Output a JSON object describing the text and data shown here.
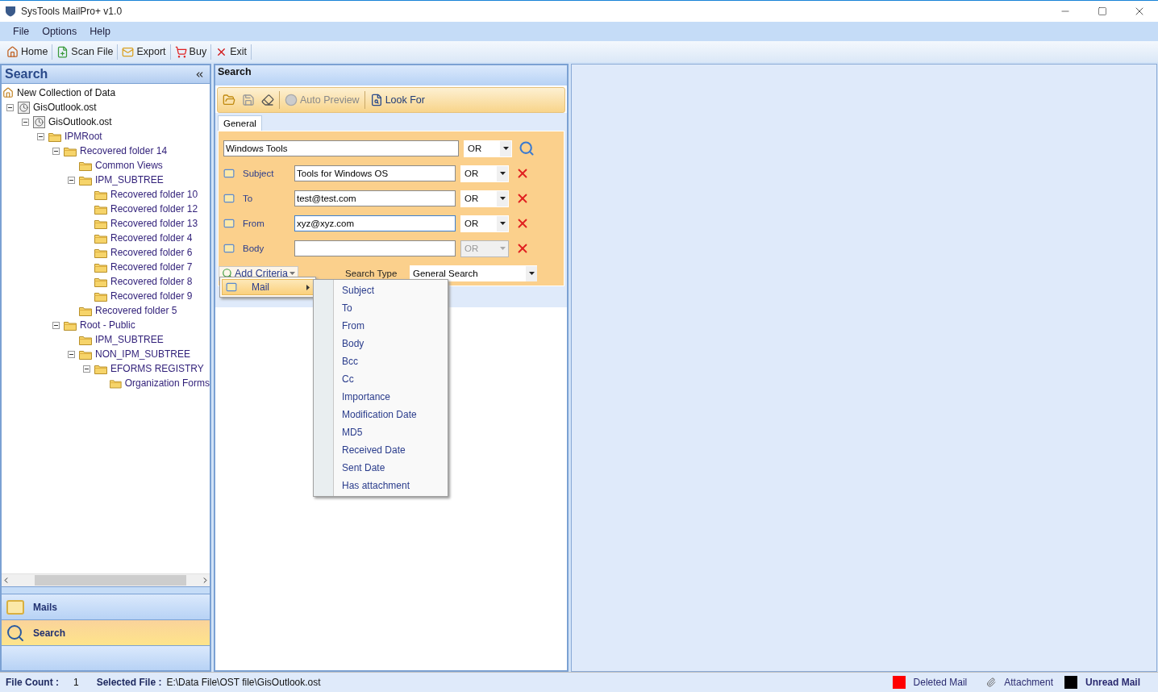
{
  "window": {
    "title": "SysTools MailPro+ v1.0"
  },
  "menu": [
    "File",
    "Options",
    "Help"
  ],
  "toolbar": [
    {
      "kind": "home",
      "label": "Home"
    },
    {
      "kind": "scan",
      "label": "Scan File"
    },
    {
      "kind": "export",
      "label": "Export"
    },
    {
      "kind": "buy",
      "label": "Buy"
    },
    {
      "kind": "exit",
      "label": "Exit"
    }
  ],
  "sidebar": {
    "title": "Search",
    "tree": [
      {
        "kind": "collection",
        "label": "New Collection of Data"
      },
      {
        "kind": "store",
        "label": "GisOutlook.ost",
        "expanded": true,
        "children": [
          {
            "kind": "store",
            "label": "GisOutlook.ost",
            "expanded": true,
            "children": [
              {
                "kind": "folder",
                "label": "IPMRoot",
                "expanded": true,
                "children": [
                  {
                    "kind": "folder",
                    "label": "Recovered folder 14",
                    "expanded": true,
                    "children": [
                      {
                        "kind": "folder",
                        "label": "Common Views"
                      },
                      {
                        "kind": "folder",
                        "label": "IPM_SUBTREE",
                        "expanded": true,
                        "children": [
                          {
                            "kind": "folder",
                            "label": "Recovered folder 10"
                          },
                          {
                            "kind": "folder",
                            "label": "Recovered folder 12"
                          },
                          {
                            "kind": "folder",
                            "label": "Recovered folder 13"
                          },
                          {
                            "kind": "folder",
                            "label": "Recovered folder 4"
                          },
                          {
                            "kind": "folder",
                            "label": "Recovered folder 6"
                          },
                          {
                            "kind": "folder",
                            "label": "Recovered folder 7"
                          },
                          {
                            "kind": "folder",
                            "label": "Recovered folder 8"
                          },
                          {
                            "kind": "folder",
                            "label": "Recovered folder 9"
                          }
                        ]
                      },
                      {
                        "kind": "folder",
                        "label": "Recovered folder 5"
                      }
                    ]
                  },
                  {
                    "kind": "folder",
                    "label": "Root - Public",
                    "expanded": true,
                    "children": [
                      {
                        "kind": "folder",
                        "label": "IPM_SUBTREE"
                      },
                      {
                        "kind": "folder",
                        "label": "NON_IPM_SUBTREE",
                        "expanded": true,
                        "children": [
                          {
                            "kind": "folder",
                            "label": "EFORMS REGISTRY",
                            "expanded": true,
                            "children": [
                              {
                                "kind": "folder",
                                "label": "Organization Forms"
                              }
                            ]
                          }
                        ]
                      }
                    ]
                  }
                ]
              }
            ]
          }
        ]
      }
    ],
    "nav": [
      {
        "kind": "mail",
        "label": "Mails",
        "selected": false
      },
      {
        "kind": "search",
        "label": "Search",
        "selected": true
      }
    ]
  },
  "search": {
    "title": "Search",
    "toolbar": [
      {
        "kind": "open"
      },
      {
        "kind": "save"
      },
      {
        "kind": "erase"
      },
      {
        "kind": "preview",
        "label": "Auto Preview",
        "disabled": true
      },
      {
        "kind": "lookfor",
        "label": "Look For",
        "disabled": false
      }
    ],
    "tabs": [
      {
        "label": "General",
        "selected": true
      }
    ],
    "query": {
      "value": "Windows Tools",
      "operator": "OR"
    },
    "criteria": [
      {
        "label": "Subject",
        "value": "Tools for Windows OS",
        "operator": "OR",
        "disabled": false,
        "focused": false
      },
      {
        "label": "To",
        "value": "test@test.com",
        "operator": "OR",
        "disabled": false,
        "focused": false
      },
      {
        "label": "From",
        "value": "xyz@xyz.com",
        "operator": "OR",
        "disabled": false,
        "focused": true
      },
      {
        "label": "Body",
        "operator": "OR",
        "disabled": true,
        "focused": false
      }
    ],
    "add_criteria": "Add Criteria",
    "search_type": {
      "label": "Search Type",
      "value": "General Search"
    },
    "popup": [
      {
        "label": "Mail",
        "highlighted": true
      }
    ],
    "submenu": [
      "Subject",
      "To",
      "From",
      "Body",
      "Bcc",
      "Cc",
      "Importance",
      "Modification Date",
      "MD5",
      "Received Date",
      "Sent Date",
      "Has attachment"
    ]
  },
  "status_bar": {
    "file_count_label": "File Count :",
    "file_count": "1",
    "selected_file_label": "Selected File :",
    "selected_file": "E:\\Data File\\OST file\\GisOutlook.ost",
    "legend": [
      {
        "kind": "swatch",
        "color": "#ff0000",
        "label": "Deleted Mail",
        "bold": false
      },
      {
        "kind": "clip",
        "label": "Attachment",
        "bold": false
      },
      {
        "kind": "swatch",
        "color": "#000000",
        "label": "Unread Mail",
        "bold": true
      }
    ]
  }
}
